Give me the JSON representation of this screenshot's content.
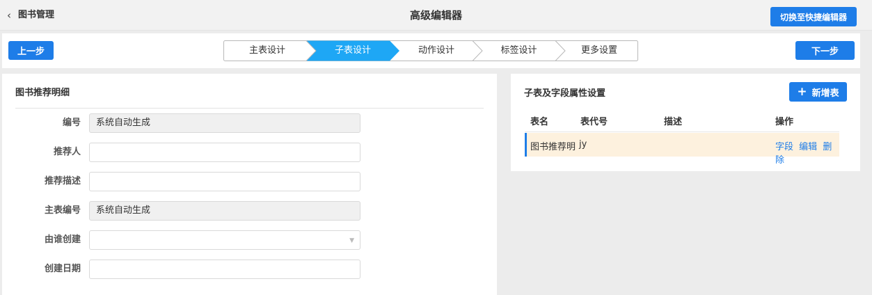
{
  "header": {
    "back_label": "图书管理",
    "title": "高级编辑器",
    "switch_button": "切换至快捷编辑器"
  },
  "steps": {
    "prev_label": "上一步",
    "next_label": "下一步",
    "items": [
      {
        "label": "主表设计",
        "active": false
      },
      {
        "label": "子表设计",
        "active": true
      },
      {
        "label": "动作设计",
        "active": false
      },
      {
        "label": "标签设计",
        "active": false
      },
      {
        "label": "更多设置",
        "active": false
      }
    ],
    "active_color": "#1ea7f5"
  },
  "form": {
    "title": "图书推荐明细",
    "fields": [
      {
        "label": "编号",
        "value": "系统自动生成",
        "readonly": true,
        "type": "text"
      },
      {
        "label": "推荐人",
        "value": "",
        "readonly": false,
        "type": "text"
      },
      {
        "label": "推荐描述",
        "value": "",
        "readonly": false,
        "type": "text"
      },
      {
        "label": "主表编号",
        "value": "系统自动生成",
        "readonly": true,
        "type": "text"
      },
      {
        "label": "由谁创建",
        "value": "",
        "readonly": false,
        "type": "select"
      },
      {
        "label": "创建日期",
        "value": "",
        "readonly": false,
        "type": "text"
      }
    ]
  },
  "subtable": {
    "title": "子表及字段属性设置",
    "add_label": "新增表",
    "columns": [
      "表名",
      "表代号",
      "描述",
      "操作"
    ],
    "rows": [
      {
        "name": "图书推荐明",
        "code": "jy",
        "desc": "",
        "ops": [
          "字段",
          "编辑",
          "删除"
        ]
      }
    ]
  },
  "colors": {
    "primary": "#1e7de8",
    "row_highlight": "#fdf1de"
  }
}
